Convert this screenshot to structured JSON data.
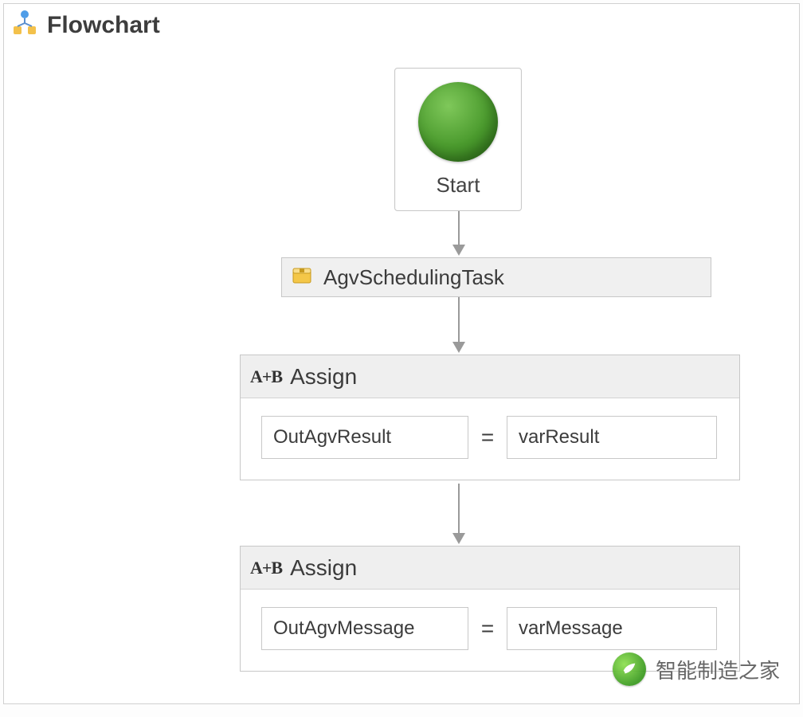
{
  "title": "Flowchart",
  "start": {
    "label": "Start"
  },
  "task": {
    "label": "AgvSchedulingTask"
  },
  "assigns": [
    {
      "header": "Assign",
      "left": "OutAgvResult",
      "right": "varResult"
    },
    {
      "header": "Assign",
      "left": "OutAgvMessage",
      "right": "varMessage"
    }
  ],
  "equals": "=",
  "ab_icon_text": "A+B",
  "watermark": "智能制造之家"
}
